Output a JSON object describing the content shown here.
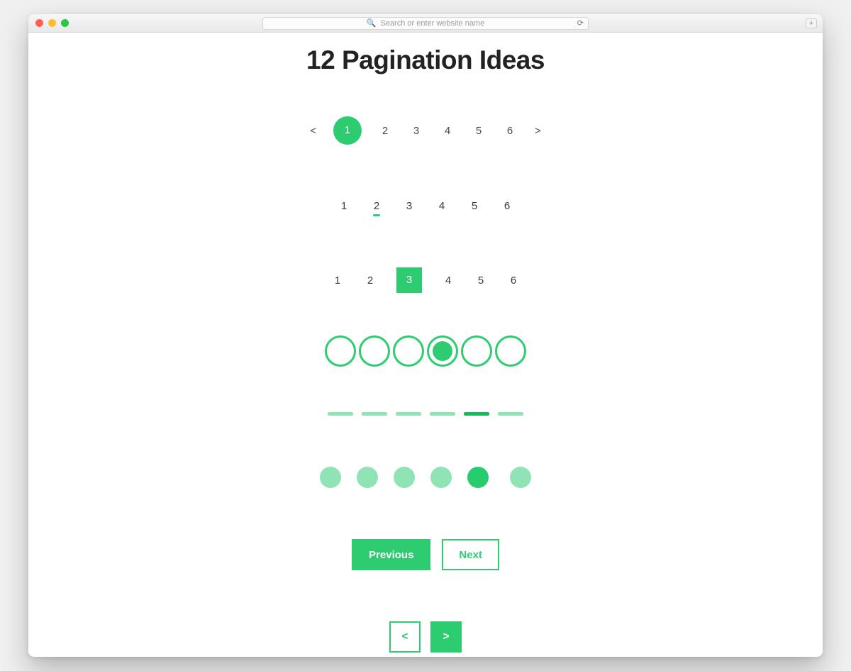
{
  "browser": {
    "address_placeholder": "Search or enter website name",
    "reload_glyph": "⟳",
    "newtab_glyph": "+"
  },
  "page": {
    "title": "12 Pagination Ideas"
  },
  "colors": {
    "accent": "#2ecc71",
    "accent_light": "#8fe3b4",
    "accent_dark": "#17b95c"
  },
  "row1": {
    "prev": "<",
    "next": ">",
    "items": [
      "1",
      "2",
      "3",
      "4",
      "5",
      "6"
    ],
    "active_index": 0
  },
  "row2": {
    "items": [
      "1",
      "2",
      "3",
      "4",
      "5",
      "6"
    ],
    "active_index": 1
  },
  "row3": {
    "items": [
      "1",
      "2",
      "3",
      "4",
      "5",
      "6"
    ],
    "active_index": 2
  },
  "row4": {
    "count": 6,
    "active_index": 3
  },
  "row5": {
    "count": 6,
    "active_index": 4
  },
  "row6": {
    "count": 6,
    "active_index": 4
  },
  "row7": {
    "prev_label": "Previous",
    "next_label": "Next"
  },
  "row8": {
    "prev": "<",
    "next": ">"
  }
}
